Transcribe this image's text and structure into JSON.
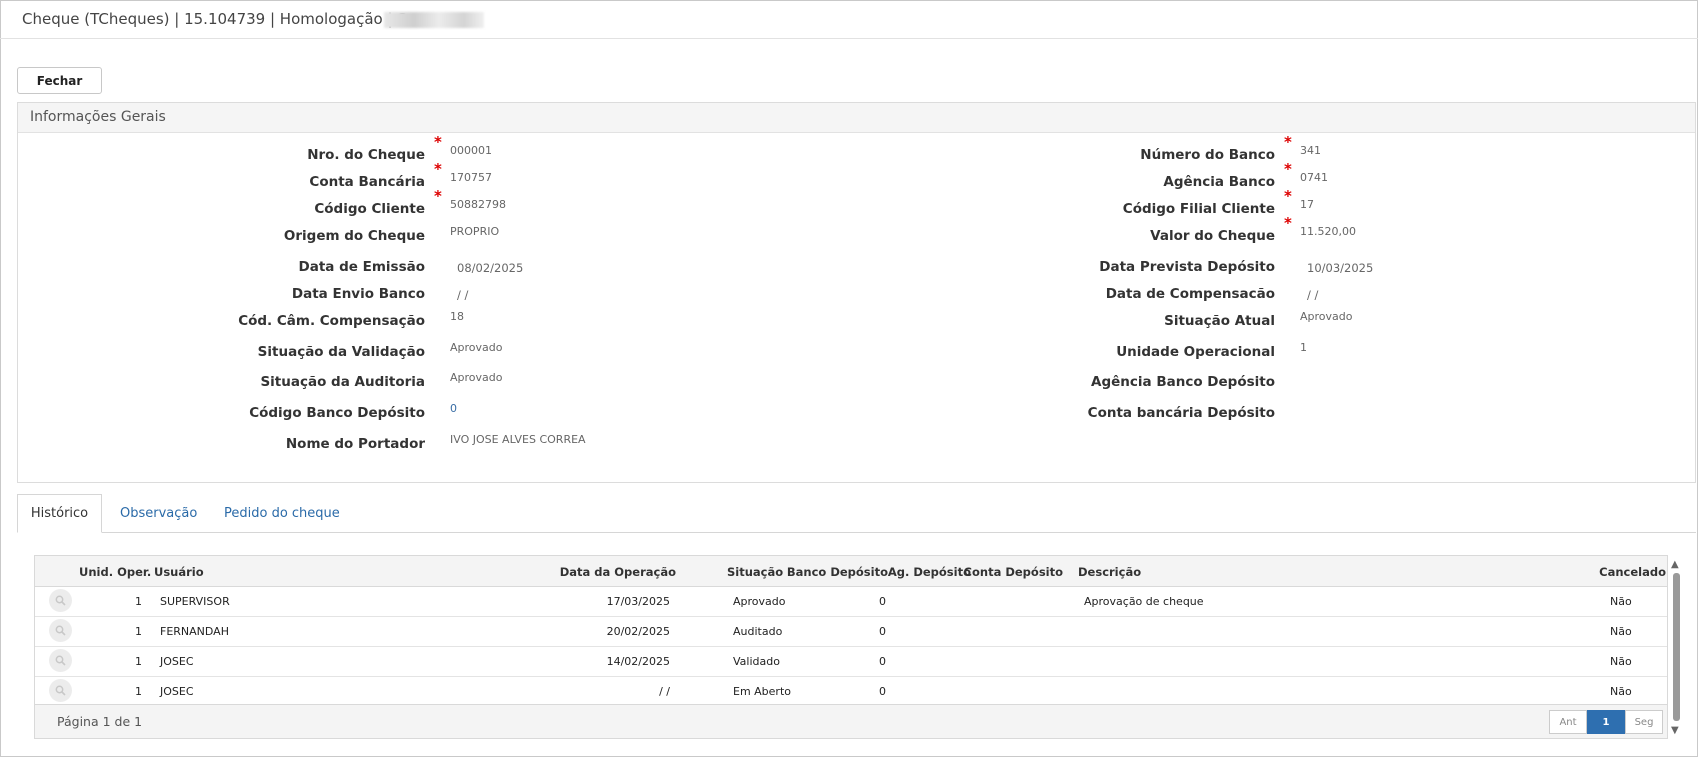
{
  "window": {
    "title": "Cheque (TCheques) | 15.104739 | Homologação | S"
  },
  "toolbar": {
    "close_label": "Fechar"
  },
  "panel": {
    "title": "Informações Gerais",
    "fields": {
      "nro_cheque": {
        "label": "Nro. do Cheque",
        "value": "000001"
      },
      "conta_bancaria": {
        "label": "Conta Bancária",
        "value": "170757"
      },
      "codigo_cliente": {
        "label": "Código Cliente",
        "value": "50882798"
      },
      "origem_cheque": {
        "label": "Origem do Cheque",
        "value": "PROPRIO"
      },
      "data_emissao": {
        "label": "Data de Emissão",
        "value": "08/02/2025"
      },
      "data_envio_banco": {
        "label": "Data Envio Banco",
        "value": " / /"
      },
      "cod_cam_compensacao": {
        "label": "Cód. Câm. Compensação",
        "value": "18"
      },
      "situacao_validacao": {
        "label": "Situação da Validação",
        "value": "Aprovado"
      },
      "situacao_auditoria": {
        "label": "Situação da Auditoria",
        "value": "Aprovado"
      },
      "codigo_banco_deposito": {
        "label": "Código Banco Depósito",
        "value": "0"
      },
      "nome_portador": {
        "label": "Nome do Portador",
        "value": "IVO JOSE ALVES CORREA"
      },
      "numero_banco": {
        "label": "Número do Banco",
        "value": "341"
      },
      "agencia_banco": {
        "label": "Agência Banco",
        "value": "0741"
      },
      "codigo_filial_cliente": {
        "label": "Código Filial Cliente",
        "value": "17"
      },
      "valor_cheque": {
        "label": "Valor do Cheque",
        "value": "11.520,00"
      },
      "data_prevista_deposito": {
        "label": "Data Prevista Depósito",
        "value": "10/03/2025"
      },
      "data_compensacao": {
        "label": "Data de Compensacão",
        "value": " / /"
      },
      "situacao_atual": {
        "label": "Situação Atual",
        "value": "Aprovado"
      },
      "unidade_operacional": {
        "label": "Unidade Operacional",
        "value": "1"
      },
      "agencia_banco_deposito": {
        "label": "Agência Banco Depósito",
        "value": ""
      },
      "conta_bancaria_deposito": {
        "label": "Conta bancária Depósito",
        "value": ""
      }
    }
  },
  "tabs": {
    "historico": "Histórico",
    "observacao": "Observação",
    "pedido": "Pedido do cheque"
  },
  "grid": {
    "columns": {
      "unid_oper": "Unid. Oper.",
      "usuario": "Usuário",
      "data_operacao": "Data da Operação",
      "situacao": "Situação",
      "banco_deposito": "Banco Depósito",
      "ag_deposito": "Ag. Depósito",
      "conta_deposito": "Conta Depósito",
      "descricao": "Descrição",
      "cancelado": "Cancelado"
    },
    "rows": [
      {
        "unid": "1",
        "usuario": "SUPERVISOR",
        "data": "17/03/2025",
        "situacao": "Aprovado",
        "banco": "0",
        "descricao": "Aprovação de cheque",
        "cancelado": "Não"
      },
      {
        "unid": "1",
        "usuario": "FERNANDAH",
        "data": "20/02/2025",
        "situacao": "Auditado",
        "banco": "0",
        "descricao": "",
        "cancelado": "Não"
      },
      {
        "unid": "1",
        "usuario": "JOSEC",
        "data": "14/02/2025",
        "situacao": "Validado",
        "banco": "0",
        "descricao": "",
        "cancelado": "Não"
      },
      {
        "unid": "1",
        "usuario": "JOSEC",
        "data": "/ /",
        "situacao": "Em Aberto",
        "banco": "0",
        "descricao": "",
        "cancelado": "Não"
      }
    ],
    "footer": {
      "page_info": "Página 1 de 1",
      "prev": "Ant",
      "current": "1",
      "next": "Seg"
    }
  },
  "icons": {
    "row_action": "magnifier-icon",
    "scroll_up": "arrow-up-icon",
    "scroll_down": "arrow-down-icon"
  },
  "colors": {
    "accent": "#2e6fb0",
    "link": "#2a6aa8",
    "required": "#dd0000"
  }
}
